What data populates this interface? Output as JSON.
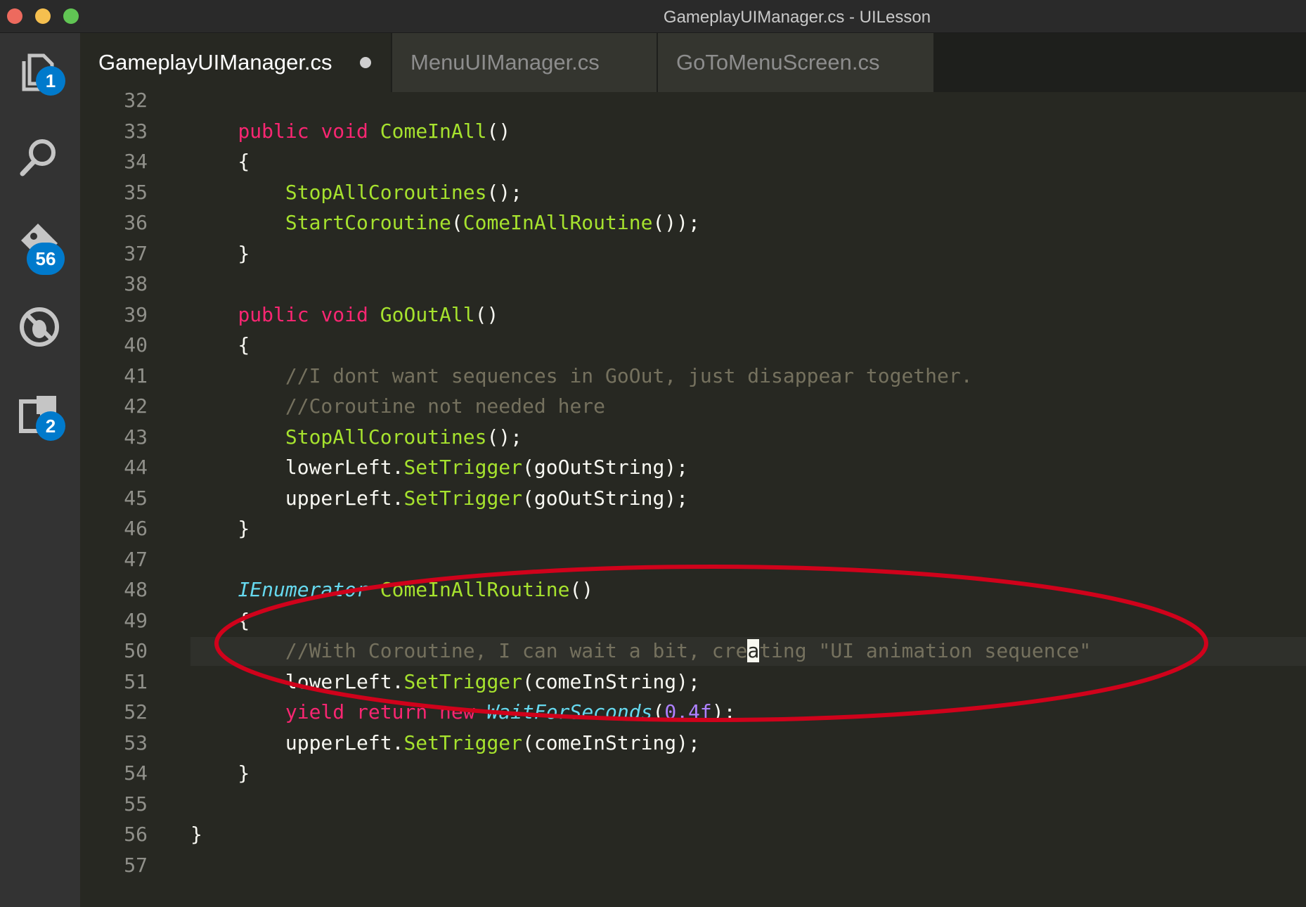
{
  "window": {
    "title": "GameplayUIManager.cs - UILesson"
  },
  "activity_bar": {
    "explorer_badge": "1",
    "scm_badge": "56",
    "extensions_badge": "2"
  },
  "tabs": [
    {
      "label": "GameplayUIManager.cs",
      "active": true,
      "modified": true
    },
    {
      "label": "MenuUIManager.cs",
      "active": false
    },
    {
      "label": "GoToMenuScreen.cs",
      "active": false
    }
  ],
  "editor": {
    "current_line": "50",
    "lines": [
      {
        "num": "32",
        "segs": []
      },
      {
        "num": "33",
        "segs": [
          {
            "t": "    "
          },
          {
            "t": "public",
            "c": "k"
          },
          {
            "t": " "
          },
          {
            "t": "void",
            "c": "k"
          },
          {
            "t": " "
          },
          {
            "t": "ComeInAll",
            "c": "f"
          },
          {
            "t": "()"
          }
        ]
      },
      {
        "num": "34",
        "segs": [
          {
            "t": "    {"
          }
        ]
      },
      {
        "num": "35",
        "segs": [
          {
            "t": "        "
          },
          {
            "t": "StopAllCoroutines",
            "c": "f"
          },
          {
            "t": "();"
          }
        ]
      },
      {
        "num": "36",
        "segs": [
          {
            "t": "        "
          },
          {
            "t": "StartCoroutine",
            "c": "f"
          },
          {
            "t": "("
          },
          {
            "t": "ComeInAllRoutine",
            "c": "f"
          },
          {
            "t": "());"
          }
        ]
      },
      {
        "num": "37",
        "segs": [
          {
            "t": "    }"
          }
        ]
      },
      {
        "num": "38",
        "segs": []
      },
      {
        "num": "39",
        "segs": [
          {
            "t": "    "
          },
          {
            "t": "public",
            "c": "k"
          },
          {
            "t": " "
          },
          {
            "t": "void",
            "c": "k"
          },
          {
            "t": " "
          },
          {
            "t": "GoOutAll",
            "c": "f"
          },
          {
            "t": "()"
          }
        ]
      },
      {
        "num": "40",
        "segs": [
          {
            "t": "    {"
          }
        ]
      },
      {
        "num": "41",
        "segs": [
          {
            "t": "        "
          },
          {
            "t": "//I dont want sequences in GoOut, just disappear together.",
            "c": "c"
          }
        ]
      },
      {
        "num": "42",
        "segs": [
          {
            "t": "        "
          },
          {
            "t": "//Coroutine not needed here",
            "c": "c"
          }
        ]
      },
      {
        "num": "43",
        "segs": [
          {
            "t": "        "
          },
          {
            "t": "StopAllCoroutines",
            "c": "f"
          },
          {
            "t": "();"
          }
        ]
      },
      {
        "num": "44",
        "segs": [
          {
            "t": "        lowerLeft."
          },
          {
            "t": "SetTrigger",
            "c": "f"
          },
          {
            "t": "(goOutString);"
          }
        ]
      },
      {
        "num": "45",
        "segs": [
          {
            "t": "        upperLeft."
          },
          {
            "t": "SetTrigger",
            "c": "f"
          },
          {
            "t": "(goOutString);"
          }
        ]
      },
      {
        "num": "46",
        "segs": [
          {
            "t": "    }"
          }
        ]
      },
      {
        "num": "47",
        "segs": []
      },
      {
        "num": "48",
        "segs": [
          {
            "t": "    "
          },
          {
            "t": "IEnumerator",
            "c": "t"
          },
          {
            "t": " "
          },
          {
            "t": "ComeInAllRoutine",
            "c": "f"
          },
          {
            "t": "()"
          }
        ]
      },
      {
        "num": "49",
        "segs": [
          {
            "t": "    {"
          }
        ]
      },
      {
        "num": "50",
        "segs": [
          {
            "t": "        "
          },
          {
            "t": "//With Coroutine, I can wait a bit, cre",
            "c": "c"
          },
          {
            "t": "a",
            "c": "cursor"
          },
          {
            "t": "ting \"UI animation sequence\"",
            "c": "c"
          }
        ]
      },
      {
        "num": "51",
        "segs": [
          {
            "t": "        lowerLeft."
          },
          {
            "t": "SetTrigger",
            "c": "f"
          },
          {
            "t": "(comeInString);"
          }
        ]
      },
      {
        "num": "52",
        "segs": [
          {
            "t": "        "
          },
          {
            "t": "yield",
            "c": "k"
          },
          {
            "t": " "
          },
          {
            "t": "return",
            "c": "k"
          },
          {
            "t": " "
          },
          {
            "t": "new",
            "c": "k"
          },
          {
            "t": " "
          },
          {
            "t": "WaitForSeconds",
            "c": "t"
          },
          {
            "t": "("
          },
          {
            "t": "0.4f",
            "c": "n"
          },
          {
            "t": ");"
          }
        ]
      },
      {
        "num": "53",
        "segs": [
          {
            "t": "        upperLeft."
          },
          {
            "t": "SetTrigger",
            "c": "f"
          },
          {
            "t": "(comeInString);"
          }
        ]
      },
      {
        "num": "54",
        "segs": [
          {
            "t": "    }"
          }
        ]
      },
      {
        "num": "55",
        "segs": []
      },
      {
        "num": "56",
        "segs": [
          {
            "t": "}"
          }
        ]
      },
      {
        "num": "57",
        "segs": []
      }
    ]
  },
  "annotation": {
    "shape": "ellipse",
    "color": "#d0021b"
  },
  "colors": {
    "editor_bg": "#272822",
    "keyword": "#f92672",
    "function": "#a6e22e",
    "type": "#66d9ef",
    "comment": "#75715e",
    "number": "#ae81ff",
    "badge": "#007acc"
  },
  "icons": [
    "files-icon",
    "search-icon",
    "source-control-icon",
    "debug-icon",
    "extensions-icon"
  ]
}
